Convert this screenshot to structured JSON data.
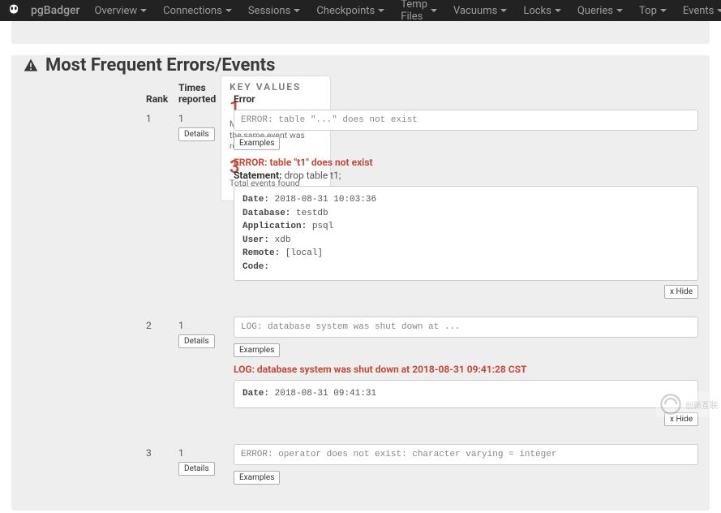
{
  "navbar": {
    "brand": "pgBadger",
    "items": [
      {
        "label": "Overview"
      },
      {
        "label": "Connections"
      },
      {
        "label": "Sessions"
      },
      {
        "label": "Checkpoints"
      },
      {
        "label": "Temp Files"
      },
      {
        "label": "Vacuums"
      },
      {
        "label": "Locks"
      },
      {
        "label": "Queries"
      },
      {
        "label": "Top"
      },
      {
        "label": "Events"
      }
    ]
  },
  "section": {
    "heading": "Most Frequent Errors/Events"
  },
  "key_values": {
    "title": "KEY VALUES",
    "block1": {
      "num": "1",
      "desc": "Max number of times the same event was reported"
    },
    "block2": {
      "num": "3",
      "desc": "Total events found"
    }
  },
  "table": {
    "headers": {
      "rank": "Rank",
      "times": "Times reported",
      "error": "Error"
    },
    "details_label": "Details",
    "examples_label": "Examples",
    "hide_label": "x Hide",
    "rows": [
      {
        "rank": "1",
        "times": "1",
        "code": "ERROR: table \"...\" does not exist",
        "err_title": "ERROR: table \"t1\" does not exist",
        "statement_label": "Statement:",
        "statement_sql": "drop table t1;",
        "detail": {
          "date_k": "Date:",
          "date_v": "2018-08-31 10:03:36",
          "db_k": "Database:",
          "db_v": "testdb",
          "app_k": "Application:",
          "app_v": "psql",
          "user_k": "User:",
          "user_v": "xdb",
          "remote_k": "Remote:",
          "remote_v": "[local]",
          "code_k": "Code:",
          "code_v": ""
        }
      },
      {
        "rank": "2",
        "times": "1",
        "code": "LOG: database system was shut down at ...",
        "log_title": "LOG: database system was shut down at 2018-08-31 09:41:28 CST",
        "detail": {
          "date_k": "Date:",
          "date_v": "2018-08-31 09:41:31"
        }
      },
      {
        "rank": "3",
        "times": "1",
        "code": "ERROR: operator does not exist: character varying = integer"
      }
    ]
  },
  "watermark": {
    "text": "创新互联"
  }
}
